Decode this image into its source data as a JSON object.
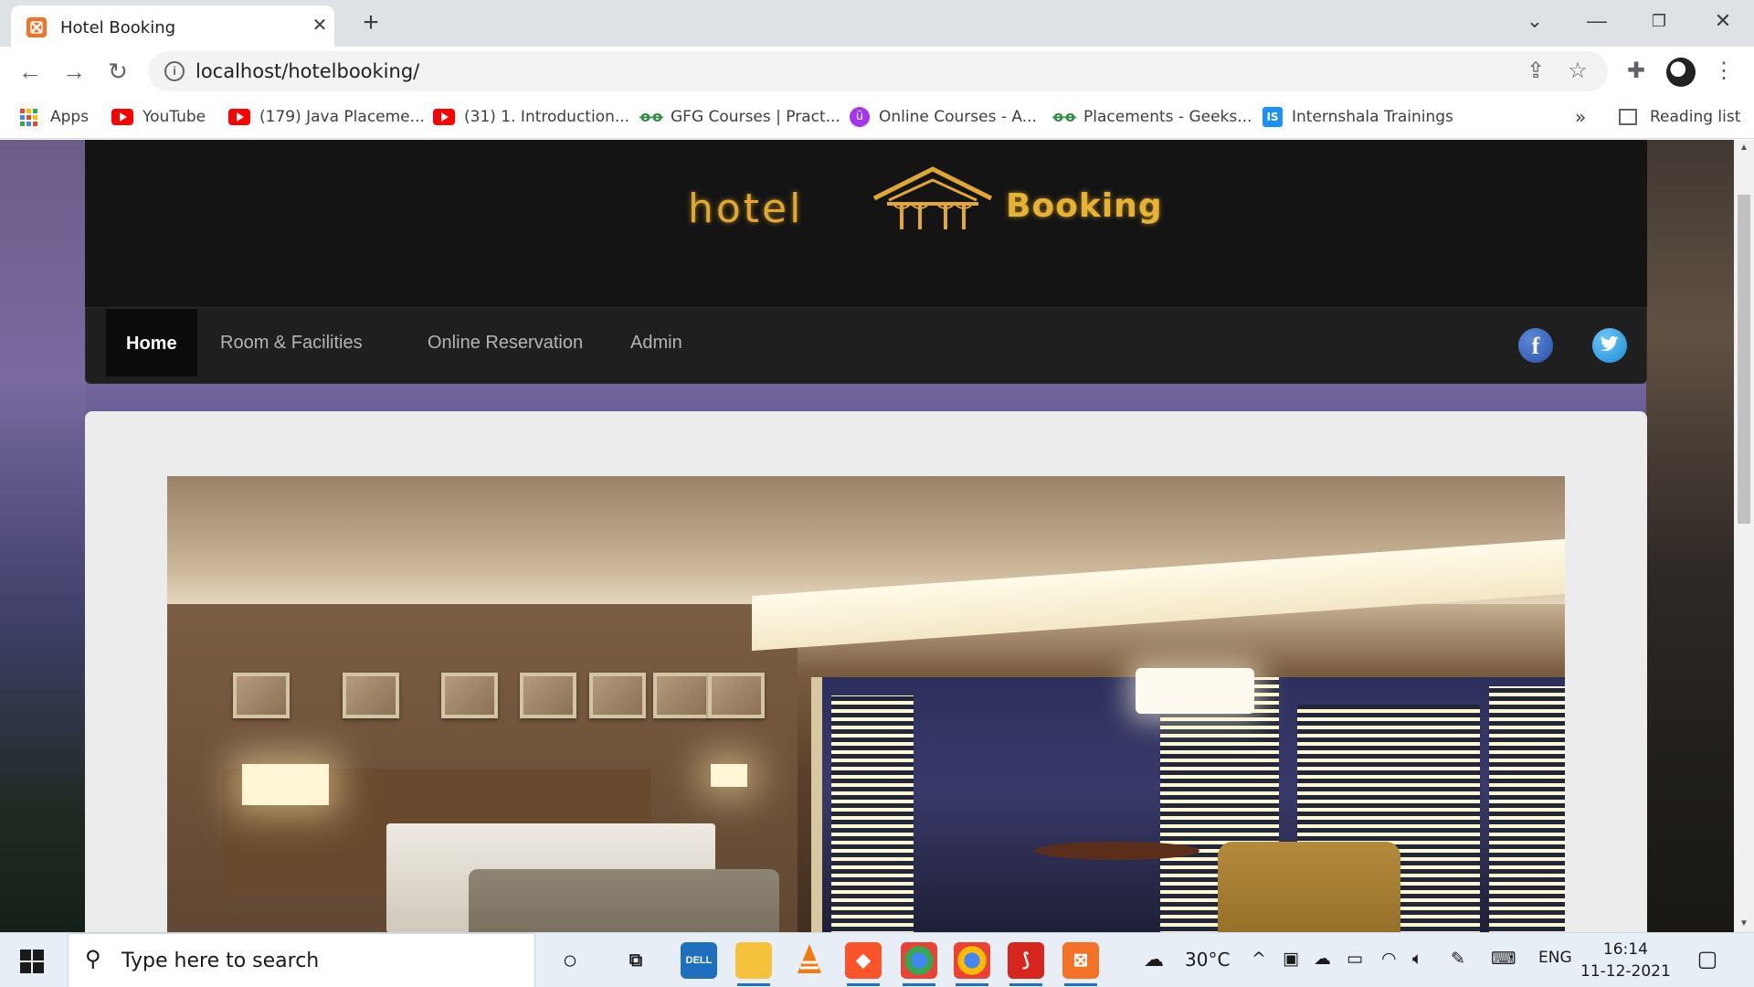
{
  "browser": {
    "tab_title": "Hotel Booking",
    "url": "localhost/hotelbooking/",
    "bookmarks": [
      {
        "label": "Apps",
        "icon": "apps-grid-icon"
      },
      {
        "label": "YouTube",
        "icon": "youtube-icon"
      },
      {
        "label": "(179) Java Placeme...",
        "icon": "youtube-icon"
      },
      {
        "label": "(31) 1. Introduction...",
        "icon": "youtube-icon"
      },
      {
        "label": "GFG Courses | Pract...",
        "icon": "gfg-icon"
      },
      {
        "label": "Online Courses - A...",
        "icon": "udemy-icon"
      },
      {
        "label": "Placements - Geeks...",
        "icon": "gfg-icon"
      },
      {
        "label": "Internshala Trainings",
        "icon": "internshala-icon"
      }
    ],
    "bookmarks_overflow": "»",
    "reading_list": "Reading list"
  },
  "site": {
    "logo_word_1": "hotel",
    "logo_word_2": "Booking",
    "nav": [
      {
        "label": "Home",
        "active": true
      },
      {
        "label": "Room & Facilities",
        "active": false
      },
      {
        "label": "Online Reservation",
        "active": false
      },
      {
        "label": "Admin",
        "active": false
      }
    ],
    "social": {
      "facebook": "f"
    }
  },
  "taskbar": {
    "search_placeholder": "Type here to search",
    "weather": "30°C",
    "language": "ENG",
    "time": "16:14",
    "date": "11-12-2021"
  },
  "colors": {
    "logo_gold": "#e0a830",
    "navbar_bg": "#1f1f1f",
    "nav_active_bg": "#0b0b0b",
    "content_bg": "#ececec"
  }
}
